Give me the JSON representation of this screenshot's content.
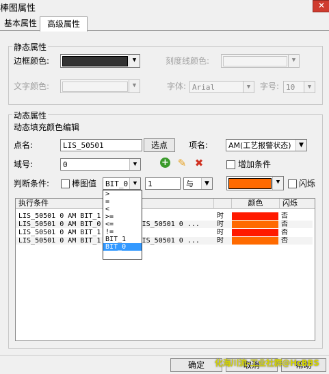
{
  "window": {
    "title": "棒图属性",
    "close": "✕"
  },
  "tabs": [
    {
      "label": "基本属性"
    },
    {
      "label": "高级属性"
    }
  ],
  "static": {
    "group_label": "静态属性",
    "border_color_label": "边框颜色:",
    "border_color": "#333333",
    "tick_color_label": "刻度线颜色:",
    "text_color_label": "文字颜色:",
    "font_label": "字体:",
    "font_value": "Arial",
    "size_label": "字号:",
    "size_value": "10"
  },
  "dynamic": {
    "group_label": "动态属性",
    "subtitle": "动态填充颜色编辑",
    "point_label": "点名:",
    "point_value": "LIS_50501",
    "select_point_btn": "选点",
    "item_label": "项名:",
    "item_value": "AM(工艺报警状态)",
    "domain_label": "域号:",
    "domain_value": "0",
    "add_condition_label": "增加条件",
    "condition_label": "判断条件:",
    "bar_value_label": "棒图值",
    "operand_value": "BIT_0",
    "compare_value": "1",
    "logic_value": "与",
    "fill_color": "#ff6a00",
    "blink_label": "闪烁"
  },
  "grid": {
    "headers": [
      "执行条件",
      "",
      "颜色",
      "闪烁"
    ],
    "rows": [
      {
        "cond": "LIS_50501 0 AM BIT_1 = 1 AND",
        "tail": "时",
        "color": "#ff1a00",
        "blink": "否"
      },
      {
        "cond": "LIS_50501 0 AM BIT_0 = 1 AND LIS_50501 0 ...",
        "tail": "时",
        "color": "#ff6a00",
        "blink": "否"
      },
      {
        "cond": "LIS_50501 0 AM BIT_1 = 1 AND",
        "tail": "时",
        "color": "#ff1a00",
        "blink": "否"
      },
      {
        "cond": "LIS_50501 0 AM BIT_1 = 1 AND LIS_50501 0 ...",
        "tail": "时",
        "color": "#ff6a00",
        "blink": "否"
      }
    ]
  },
  "operand_menu": {
    "options": [
      ">",
      "=",
      "<",
      ">=",
      "<=",
      "!=",
      "BIT_1",
      "BIT_0"
    ],
    "selected": "BIT_0"
  },
  "footer": {
    "ok": "确定",
    "cancel": "取消",
    "help": "帮助",
    "watermark": "化海川流-工业社群@HcBBS"
  }
}
